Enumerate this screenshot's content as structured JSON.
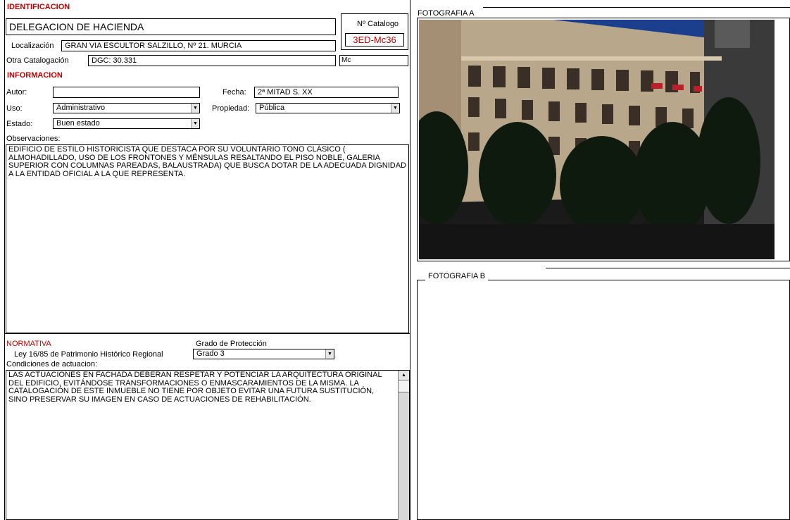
{
  "identificacion": {
    "section_title": "IDENTIFICACION",
    "name": "DELEGACION DE HACIENDA",
    "catalog_label": "Nº Catalogo",
    "catalog_value": "3ED-Mc36",
    "localizacion_label": "Localización",
    "localizacion_value": "GRAN VIA ESCULTOR SALZILLO, Nº 21. MURCIA",
    "otra_label": "Otra Catalogación",
    "otra_value": "DGC: 30.331",
    "mc_value": "Mc"
  },
  "informacion": {
    "section_title": "INFORMACION",
    "autor_label": "Autor:",
    "autor_value": "",
    "fecha_label": "Fecha:",
    "fecha_value": "2ª MITAD S. XX",
    "uso_label": "Uso:",
    "uso_value": "Administrativo",
    "propiedad_label": "Propiedad:",
    "propiedad_value": "Pública",
    "estado_label": "Estado:",
    "estado_value": "Buen estado",
    "observaciones_label": "Observaciones:",
    "observaciones_text": "EDIFICIO DE ESTILO HISTORICISTA  QUE DESTACA POR SU VOLUNTARIO TONO CLÁSICO ( ALMOHADILLADO,  USO DE LOS FRONTONES Y MÉNSULAS RESALTANDO EL PISO NOBLE, GALERIA SUPERIOR CON COLUMNAS PAREADAS, BALAUSTRADA) QUE  BUSCA DOTAR DE LA ADECUADA DIGNIDAD A LA ENTIDAD OFICIAL A LA QUE REPRESENTA."
  },
  "normativa": {
    "section_title": "NORMATIVA",
    "ley_label": "Ley 16/85 de Patrimonio Histórico Regional",
    "grado_label": "Grado de Protección",
    "grado_value": "Grado 3",
    "condiciones_label": "Condiciones de actuacion:",
    "condiciones_text": "LAS ACTUACIONES EN FACHADA DEBERAN RESPETAR Y POTENCIAR LA ARQUITECTURA ORIGINAL DEL EDIFICIO, EVITÁNDOSE TRANSFORMACIONES O ENMASCARAMIENTOS DE LA MISMA. LA CATALOGACIÓN DE ESTE INMUEBLE NO TIENE POR OBJETO EVITAR UNA FUTURA SUSTITUCIÓN, SINO PRESERVAR SU IMAGEN EN CASO DE ACTUACIONES DE REHABILITACIÓN."
  },
  "photos": {
    "a_label": "FOTOGRAFIA A",
    "b_label": "FOTOGRAFIA B"
  },
  "colors": {
    "section_red": "#c00000",
    "sky": "#1b3f8c"
  }
}
